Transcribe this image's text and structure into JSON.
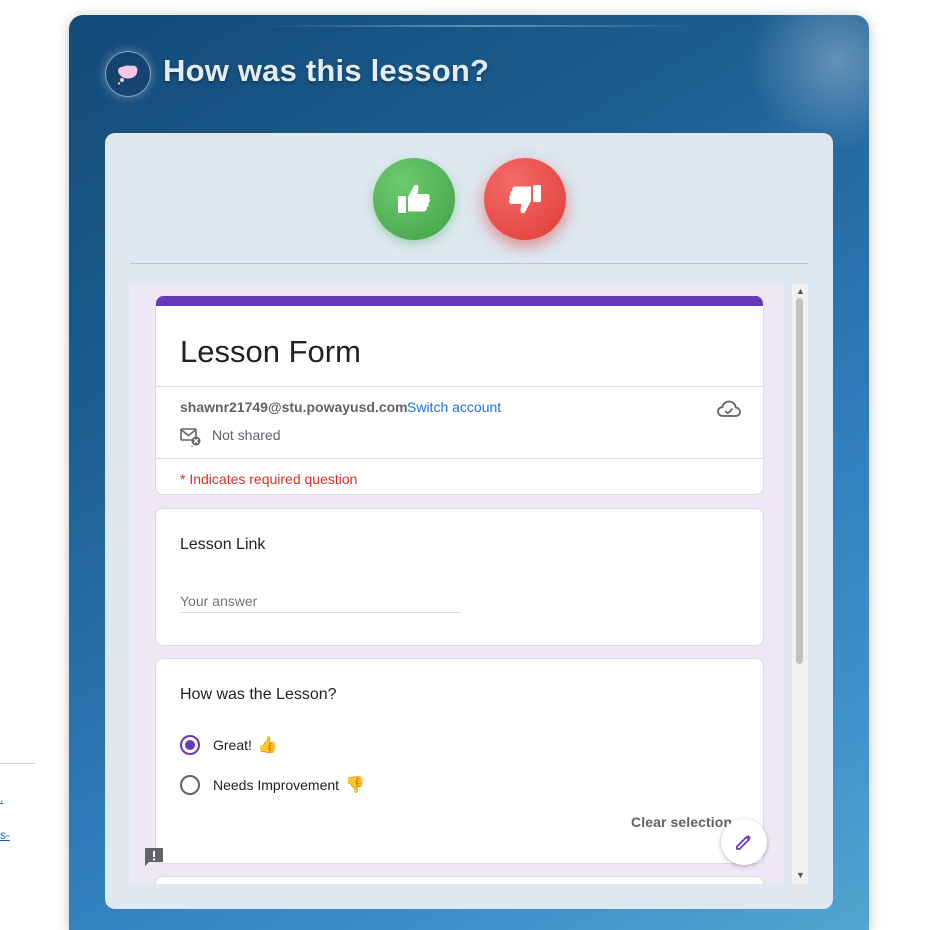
{
  "modal": {
    "title": "How was this lesson?",
    "icon": "thought-bubble-icon"
  },
  "vote": {
    "up_icon": "thumbs-up-icon",
    "down_icon": "thumbs-down-icon",
    "up_color": "#4caf50",
    "down_color": "#e53935"
  },
  "form": {
    "title": "Lesson Form",
    "accent_color": "#673ab7",
    "account": {
      "email": "shawnr21749@stu.powayusd.com",
      "switch_label": "Switch account"
    },
    "sharing_status": "Not shared",
    "required_note": "* Indicates required question",
    "questions": [
      {
        "title": "Lesson Link",
        "placeholder": "Your answer"
      },
      {
        "title": "How was the Lesson?",
        "options": [
          {
            "label": "Great!",
            "emoji": "👍",
            "selected": true
          },
          {
            "label": "Needs Improvement",
            "emoji": "👎",
            "selected": false
          }
        ],
        "clear_label": "Clear selection"
      }
    ]
  }
}
